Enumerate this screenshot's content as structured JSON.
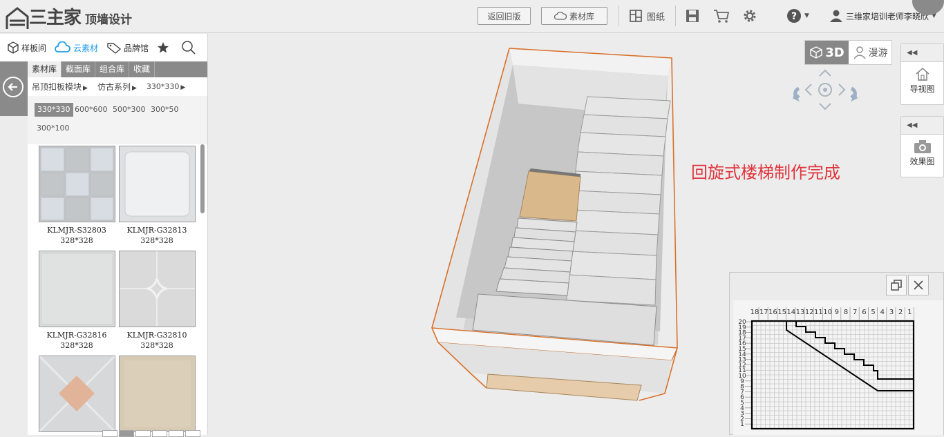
{
  "app": {
    "logo_mark": "三主家",
    "logo_title": "顶墙设计"
  },
  "toolbar": {
    "back_old_label": "返回旧版",
    "library_label": "素材库",
    "drawings_label": "图纸",
    "help_icon": "help-icon",
    "user_name": "三维家培训老师李晓欣"
  },
  "left": {
    "nav": [
      {
        "label": "样板间",
        "icon": "cube-icon"
      },
      {
        "label": "云素材",
        "icon": "cloud-icon"
      },
      {
        "label": "品牌馆",
        "icon": "tag-icon"
      }
    ],
    "tabs": [
      "素材库",
      "截面库",
      "组合库",
      "收藏"
    ],
    "categories": [
      "吊顶扣板模块",
      "仿古系列",
      "330*330"
    ],
    "sizes": [
      "330*330",
      "600*600",
      "500*300",
      "300*50",
      "300*100"
    ],
    "items": [
      {
        "name": "KLMJR-S32803",
        "size": "328*328",
        "color": "#c9ccd0"
      },
      {
        "name": "KLMJR-G32813",
        "size": "328*328",
        "color": "#e2e3e4"
      },
      {
        "name": "KLMJR-G32816",
        "size": "328*328",
        "color": "#dcdcdc"
      },
      {
        "name": "KLMJR-G32810",
        "size": "328*328",
        "color": "#d9d9d9"
      },
      {
        "name": "",
        "size": "",
        "color": "#d8d8d8"
      },
      {
        "name": "",
        "size": "",
        "color": "#d8cbb5"
      }
    ]
  },
  "canvas": {
    "annotation": "回旋式楼梯制作完成",
    "view_3d_label": "3D",
    "view_roam_label": "漫游",
    "panel_nav_label": "导视图",
    "panel_render_label": "效果图"
  },
  "minimap": {
    "top_ruler": [
      "18",
      "17",
      "16",
      "15",
      "14",
      "13",
      "12",
      "11",
      "10",
      "9",
      "8",
      "7",
      "6",
      "5",
      "4",
      "3",
      "2",
      "1"
    ],
    "left_ruler": [
      "20",
      "19",
      "18",
      "17",
      "16",
      "15",
      "14",
      "13",
      "12",
      "11",
      "10",
      "9",
      "8",
      "7",
      "6",
      "5",
      "4",
      "3",
      "2",
      "1"
    ]
  },
  "colors": {
    "accent": "#e0343c",
    "cloud": "#1e9be8"
  }
}
